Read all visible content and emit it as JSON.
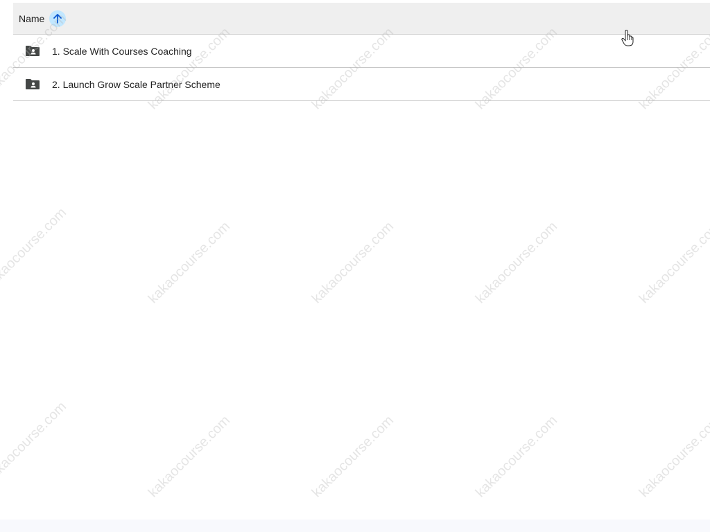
{
  "file_list": {
    "header": {
      "name_label": "Name",
      "sort_icon": "arrow-up-icon",
      "sort_direction": "ascending"
    },
    "rows": [
      {
        "name": "1. Scale With Courses Coaching",
        "icon": "shared-folder-icon"
      },
      {
        "name": "2. Launch Grow Scale Partner Scheme",
        "icon": "shared-folder-icon"
      }
    ]
  },
  "watermark": {
    "text": "kakaocourse.com"
  },
  "colors": {
    "header_bg": "#efefef",
    "sort_highlight": "#c2e7ff",
    "sort_arrow": "#0b57d0",
    "folder_icon": "#444746",
    "divider": "#c7c7c7"
  }
}
